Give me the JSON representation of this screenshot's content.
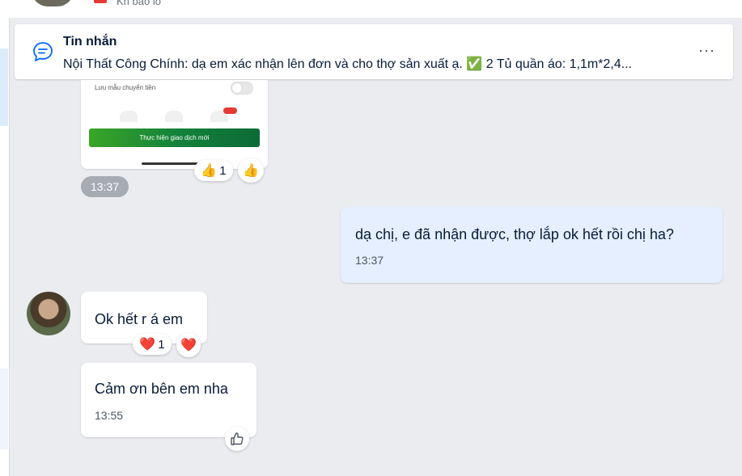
{
  "top_bar": {
    "faded_text": "Kh bảo lo"
  },
  "pinned": {
    "title": "Tin nhắn",
    "preview": "Nội Thất Công Chính: dạ em xác nhận lên đơn và cho thợ sản xuất ạ. ✅ 2 Tủ quần áo: 1,1m*2,4...",
    "more": "···"
  },
  "image_message": {
    "save_label": "Lưu mẫu chuyển tiền",
    "button_label": "Thực hiện giao dịch mới",
    "reaction_count": "1",
    "reaction_emoji": "👍",
    "quick_reaction": "👍",
    "time": "13:37"
  },
  "my_message": {
    "text": "dạ chị, e đã nhận được, thợ lắp ok hết rồi chị ha?",
    "time": "13:37"
  },
  "their_messages": [
    {
      "text": "Ok hết r á em",
      "reaction_emoji": "❤️",
      "reaction_count": "1",
      "quick_reaction": "❤️"
    },
    {
      "text": "Cảm ơn bên em nha",
      "time": "13:55"
    }
  ],
  "colors": {
    "my_bubble": "#e5efff",
    "chat_bg": "#ebecf0",
    "accent": "#0068ff"
  }
}
